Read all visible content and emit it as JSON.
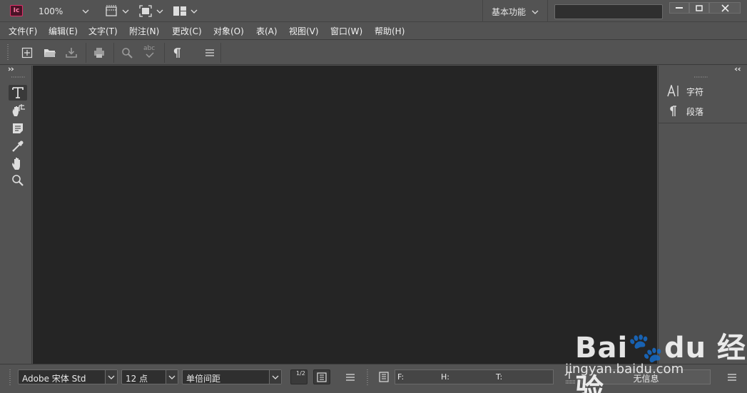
{
  "app": {
    "logo_text": "Ic"
  },
  "titlebar": {
    "zoom": "100%",
    "workspace": "基本功能",
    "search_value": ""
  },
  "menu": [
    {
      "label": "文件(F)"
    },
    {
      "label": "编辑(E)"
    },
    {
      "label": "文字(T)"
    },
    {
      "label": "附注(N)"
    },
    {
      "label": "更改(C)"
    },
    {
      "label": "对象(O)"
    },
    {
      "label": "表(A)"
    },
    {
      "label": "视图(V)"
    },
    {
      "label": "窗口(W)"
    },
    {
      "label": "帮助(H)"
    }
  ],
  "toolbar": {
    "icons": [
      "new-icon",
      "open-folder-icon",
      "import-icon",
      "print-icon",
      "find-icon",
      "spellcheck-icon",
      "pilcrow-icon",
      "menu-icon"
    ],
    "spellcheck_glyph": "abc"
  },
  "tools": [
    "type-tool",
    "position-tool",
    "note-tool",
    "eyedropper-tool",
    "hand-tool",
    "zoom-tool"
  ],
  "right_panel": {
    "items": [
      {
        "label": "字符",
        "icon": "character-icon"
      },
      {
        "label": "段落",
        "icon": "paragraph-icon"
      }
    ]
  },
  "bottom": {
    "font": "Adobe 宋体 Std",
    "size": "12 点",
    "spacing": "单倍间距",
    "toggle_a": "1/2",
    "f_label": "F:",
    "h_label": "H:",
    "t_label": "T:",
    "no_info": "无信息"
  },
  "watermark": {
    "main": "Bai🐾du 经验",
    "sub": "jingyan.baidu.com"
  },
  "colors": {
    "canvas": "#252525",
    "chrome": "#535353",
    "accent": "#e0306a"
  }
}
